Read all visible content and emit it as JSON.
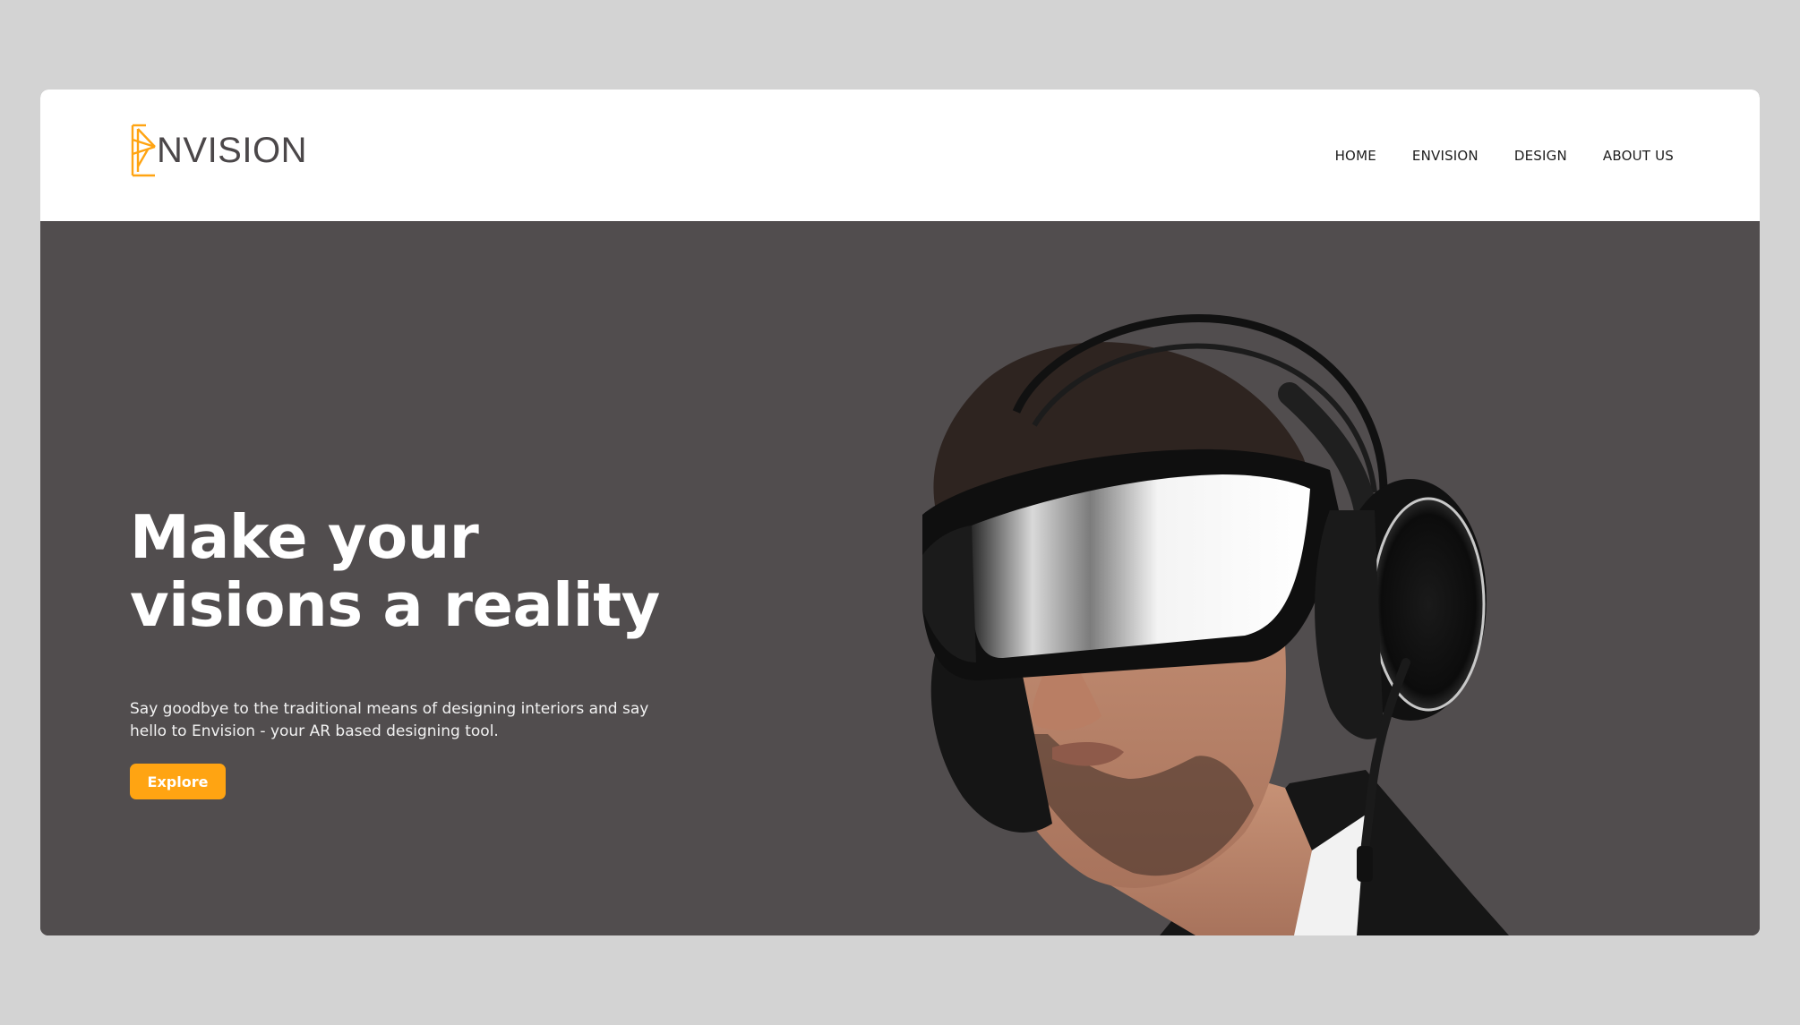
{
  "brand": {
    "logo_text": "NVISION",
    "logo_icon": "stylized-e-logo-icon",
    "accent_color": "#ffa412",
    "text_color": "#4b4749"
  },
  "nav": {
    "items": [
      {
        "label": "HOME"
      },
      {
        "label": "ENVISION"
      },
      {
        "label": "DESIGN"
      },
      {
        "label": "ABOUT US"
      }
    ]
  },
  "hero": {
    "title_line1": "Make your",
    "title_line2": "visions a reality",
    "subtitle_line1": "Say goodbye to the traditional means of designing interiors and say",
    "subtitle_line2": "hello to Envision - your AR based designing tool.",
    "cta_label": "Explore",
    "background_color": "#514d4e",
    "image": "man-wearing-ar-visor-and-headphones"
  }
}
